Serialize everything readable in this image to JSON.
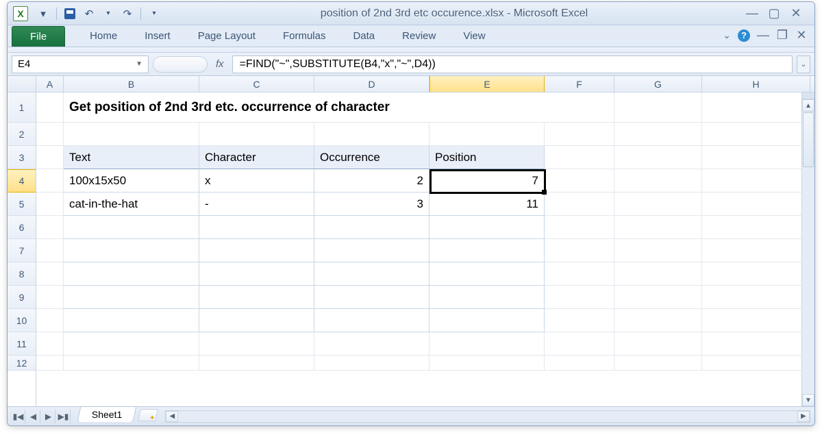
{
  "title": "position of 2nd 3rd etc occurence.xlsx  -  Microsoft Excel",
  "ribbon": {
    "file": "File",
    "tabs": [
      "Home",
      "Insert",
      "Page Layout",
      "Formulas",
      "Data",
      "Review",
      "View"
    ]
  },
  "name_box": "E4",
  "formula": "=FIND(\"~\",SUBSTITUTE(B4,\"x\",\"~\",D4))",
  "columns": [
    "A",
    "B",
    "C",
    "D",
    "E",
    "F",
    "G",
    "H"
  ],
  "active_col": "E",
  "rows": [
    "1",
    "2",
    "3",
    "4",
    "5",
    "6",
    "7",
    "8",
    "9",
    "10",
    "11",
    "12"
  ],
  "active_row": "4",
  "heading": "Get position of 2nd 3rd etc. occurrence of character",
  "headers": {
    "text": "Text",
    "char": "Character",
    "occ": "Occurrence",
    "pos": "Position"
  },
  "data": [
    {
      "text": "100x15x50",
      "char": "x",
      "occ": "2",
      "pos": "7"
    },
    {
      "text": "cat-in-the-hat",
      "char": "-",
      "occ": "3",
      "pos": "11"
    }
  ],
  "sheet_tab": "Sheet1"
}
